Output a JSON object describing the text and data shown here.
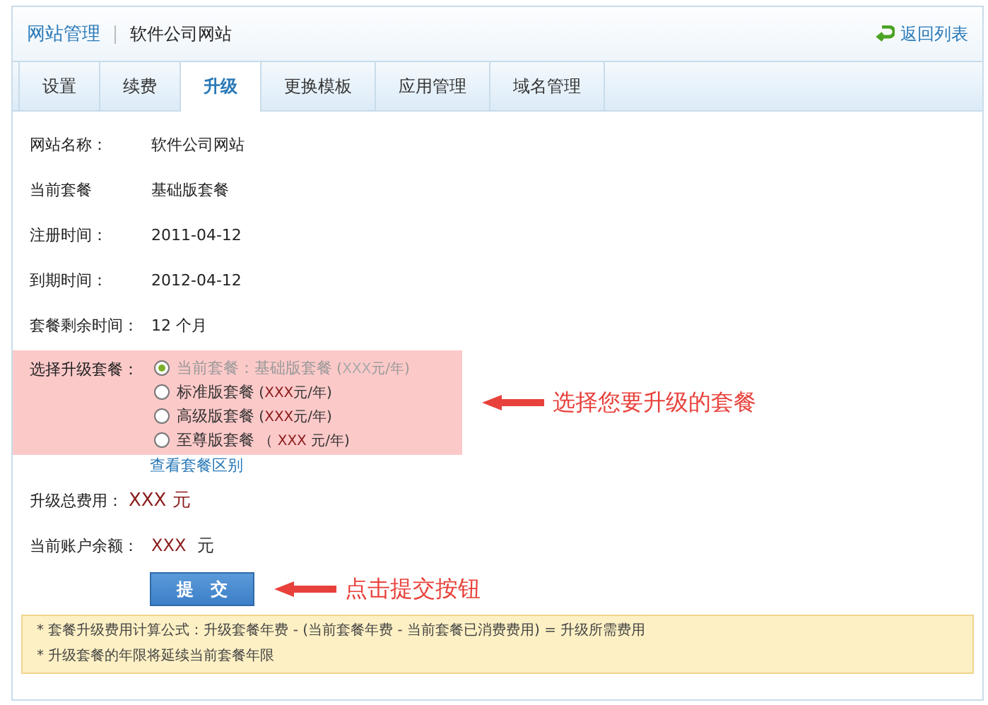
{
  "header": {
    "section": "网站管理",
    "site": "软件公司网站",
    "back_link": "返回列表"
  },
  "tabs": [
    {
      "label": "设置",
      "selected": false
    },
    {
      "label": "续费",
      "selected": false
    },
    {
      "label": "升级",
      "selected": true
    },
    {
      "label": "更换模板",
      "selected": false
    },
    {
      "label": "应用管理",
      "selected": false
    },
    {
      "label": "域名管理",
      "selected": false
    }
  ],
  "info": [
    {
      "label": "网站名称：",
      "value": "软件公司网站"
    },
    {
      "label": "当前套餐",
      "value": "基础版套餐"
    },
    {
      "label": "注册时间：",
      "value": "2011-04-12"
    },
    {
      "label": "到期时间：",
      "value": "2012-04-12"
    },
    {
      "label": "套餐剩余时间：",
      "value": "12 个月"
    }
  ],
  "plan_select": {
    "label": "选择升级套餐：",
    "options": [
      {
        "name": "当前套餐：基础版套餐",
        "prefix": " (",
        "amount": "XXX",
        "suffix": "元/年)",
        "selected": true,
        "disabled": true
      },
      {
        "name": "标准版套餐",
        "prefix": " (",
        "amount": "XXX",
        "suffix": "元/年)",
        "selected": false,
        "disabled": false
      },
      {
        "name": "高级版套餐",
        "prefix": " (",
        "amount": "XXX",
        "suffix": "元/年)",
        "selected": false,
        "disabled": false
      },
      {
        "name": "至尊版套餐",
        "prefix": " （ ",
        "amount": "XXX",
        "suffix": " 元/年)",
        "selected": false,
        "disabled": false
      }
    ],
    "compare_link": "查看套餐区别",
    "annotation": "选择您要升级的套餐"
  },
  "total": {
    "label": "升级总费用：",
    "amount": "XXX",
    "unit": "元"
  },
  "balance": {
    "label": "当前账户余额：",
    "amount": "XXX",
    "unit": "元"
  },
  "submit": {
    "label": "提　交",
    "annotation": "点击提交按钮"
  },
  "notes": [
    "* 套餐升级费用计算公式：升级套餐年费  - (当前套餐年费  - 当前套餐已消费费用) = 升级所需费用",
    "* 升级套餐的年限将延续当前套餐年限"
  ]
}
